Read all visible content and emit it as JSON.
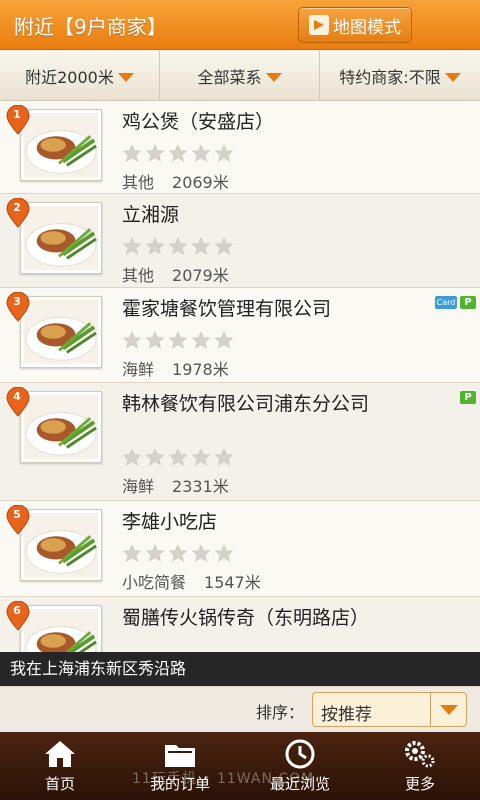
{
  "header": {
    "title": "附近【9户商家】",
    "map_button": "地图模式"
  },
  "filters": [
    {
      "label": "附近2000米",
      "width": 160
    },
    {
      "label": "全部菜系",
      "width": 160
    },
    {
      "label": "特约商家:不限",
      "width": 160
    }
  ],
  "restaurants": [
    {
      "index": "1",
      "name": "鸡公煲（安盛店）",
      "category": "其他",
      "distance": "2069米",
      "badges": []
    },
    {
      "index": "2",
      "name": "立湘源",
      "category": "其他",
      "distance": "2079米",
      "badges": []
    },
    {
      "index": "3",
      "name": "霍家塘餐饮管理有限公司",
      "category": "海鲜",
      "distance": "1978米",
      "badges": [
        "Card",
        "P"
      ]
    },
    {
      "index": "4",
      "name": "韩林餐饮有限公司浦东分公司",
      "category": "海鲜",
      "distance": "2331米",
      "badges": [
        "P"
      ]
    },
    {
      "index": "5",
      "name": "李雄小吃店",
      "category": "小吃简餐",
      "distance": "1547米",
      "badges": []
    },
    {
      "index": "6",
      "name": "蜀膳传火锅传奇（东明路店）",
      "category": "",
      "distance": "",
      "badges": []
    }
  ],
  "location_text": "我在上海浦东新区秀沿路",
  "sort": {
    "label": "排序：",
    "value": "按推荐"
  },
  "tabs": [
    {
      "label": "首页",
      "icon": "home-icon"
    },
    {
      "label": "我的订单",
      "icon": "folder-icon"
    },
    {
      "label": "最近浏览",
      "icon": "history-icon"
    },
    {
      "label": "更多",
      "icon": "gear-icon"
    }
  ],
  "watermark": "11玩手机 • 11WAN.COM",
  "colors": {
    "accent": "#ea7d0f",
    "tabbar": "#3a1a0b",
    "location_bar": "#262626"
  }
}
